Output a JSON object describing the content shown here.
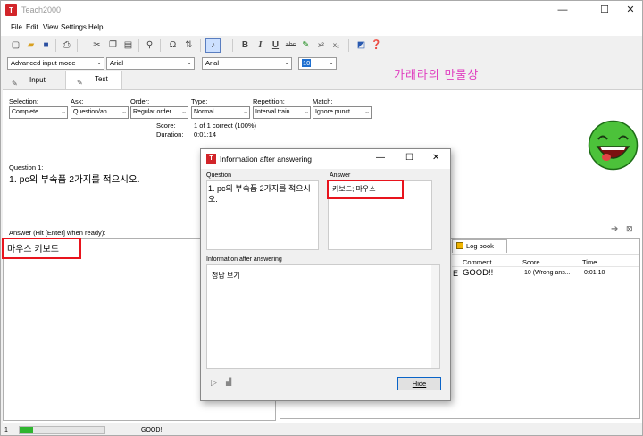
{
  "window": {
    "title": "Teach2000",
    "app_icon": "T",
    "minimize": "—",
    "maximize": "☐",
    "close": "✕"
  },
  "menu": [
    "File",
    "Edit",
    "View",
    "Settings",
    "Help"
  ],
  "toolbar": {
    "icons": [
      "new-icon",
      "open-icon",
      "save-icon",
      "print-icon",
      "cut-icon",
      "copy-icon",
      "paste-icon",
      "find-icon",
      "symbol-icon",
      "sort-icon",
      "music-note-icon",
      "bold-icon",
      "italic-icon",
      "underline-icon",
      "strikethrough-icon",
      "highlight-icon",
      "superscript-icon",
      "subscript-icon",
      "spellcheck-icon",
      "help-icon"
    ],
    "bold": "B",
    "italic": "I",
    "underline": "U",
    "strike": "abc",
    "superscript": "x²",
    "subscript": "x₂"
  },
  "combos": {
    "mode": "Advanced input mode",
    "font1": "Arial",
    "font2": "Arial",
    "size": "10"
  },
  "watermark": "가래라의 만물상",
  "tabs": {
    "input": "Input",
    "test": "Test"
  },
  "options": {
    "selection": {
      "label": "Selection:",
      "value": "Complete"
    },
    "ask": {
      "label": "Ask:",
      "value": "Question/an..."
    },
    "order": {
      "label": "Order:",
      "value": "Regular order"
    },
    "type": {
      "label": "Type:",
      "value": "Normal"
    },
    "repetition": {
      "label": "Repetition:",
      "value": "Interval train..."
    },
    "match": {
      "label": "Match:",
      "value": "Ignore punct..."
    }
  },
  "score": {
    "label": "Score:",
    "value": "1 of 1 correct (100%)"
  },
  "duration": {
    "label": "Duration:",
    "value": "0:01:14"
  },
  "question": {
    "label": "Question 1:",
    "text": "1. pc의 부속품 2가지를 적으시오."
  },
  "answer": {
    "label": "Answer (Hit [Enter] when ready):",
    "value": "마우스 키보드"
  },
  "log": {
    "tab_label": "Log book",
    "columns": [
      "Comment",
      "Score",
      "Time"
    ],
    "row": {
      "prefix": "E",
      "comment": "GOOD!!",
      "score": "10 (Wrong ans...",
      "time": "0:01:10"
    }
  },
  "dialog": {
    "title": "Information after answering",
    "question_label": "Question",
    "question_text": "1. pc의 부속품 2가지를 적으시오.",
    "answer_label": "Answer",
    "answer_text": "키보드; 마우스",
    "info_label": "Information after answering",
    "info_text": "정답 보기",
    "hide_button": "Hide",
    "minimize": "—",
    "maximize": "☐",
    "close": "✕"
  },
  "status": {
    "left": "1",
    "message": "GOOD!!",
    "progress": 0.16
  },
  "colors": {
    "highlight_box": "#e8141d",
    "smiley": "#4cc23a",
    "watermark": "#e040c0",
    "progress": "#2fb52f"
  }
}
